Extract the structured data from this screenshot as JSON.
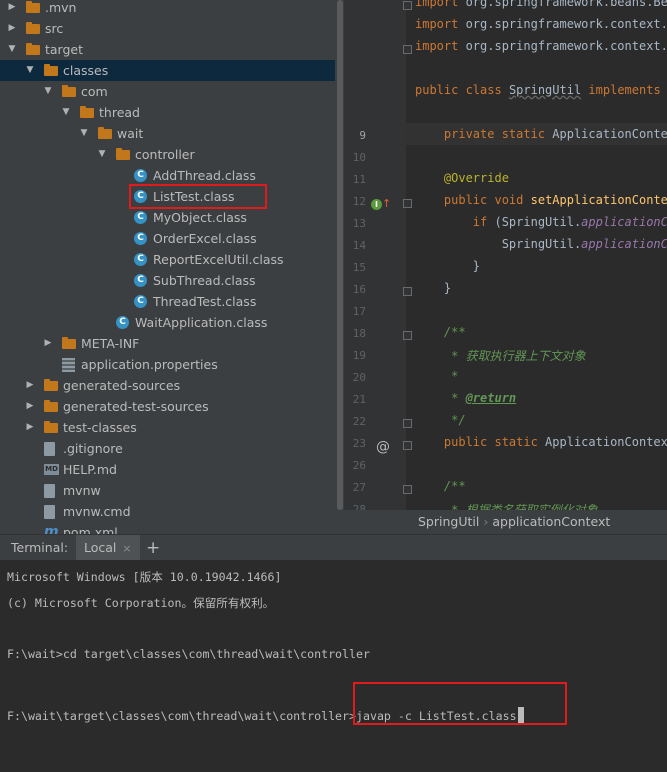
{
  "tree": {
    "items": [
      {
        "label": ".mvn",
        "icon": "folder",
        "depth": 0,
        "arrow": "right"
      },
      {
        "label": "src",
        "icon": "folder",
        "depth": 0,
        "arrow": "right"
      },
      {
        "label": "target",
        "icon": "folder",
        "depth": 0,
        "arrow": "down"
      },
      {
        "label": "classes",
        "icon": "folder",
        "depth": 1,
        "arrow": "down",
        "selected": true
      },
      {
        "label": "com",
        "icon": "folder",
        "depth": 2,
        "arrow": "down"
      },
      {
        "label": "thread",
        "icon": "folder",
        "depth": 3,
        "arrow": "down"
      },
      {
        "label": "wait",
        "icon": "folder",
        "depth": 4,
        "arrow": "down"
      },
      {
        "label": "controller",
        "icon": "folder",
        "depth": 5,
        "arrow": "down"
      },
      {
        "label": "AddThread.class",
        "icon": "class",
        "depth": 6
      },
      {
        "label": "ListTest.class",
        "icon": "class",
        "depth": 6,
        "highlighted": true
      },
      {
        "label": "MyObject.class",
        "icon": "class",
        "depth": 6
      },
      {
        "label": "OrderExcel.class",
        "icon": "class",
        "depth": 6
      },
      {
        "label": "ReportExcelUtil.class",
        "icon": "class",
        "depth": 6
      },
      {
        "label": "SubThread.class",
        "icon": "class",
        "depth": 6
      },
      {
        "label": "ThreadTest.class",
        "icon": "class",
        "depth": 6
      },
      {
        "label": "WaitApplication.class",
        "icon": "class",
        "depth": 5
      },
      {
        "label": "META-INF",
        "icon": "folder",
        "depth": 2,
        "arrow": "right"
      },
      {
        "label": "application.properties",
        "icon": "properties",
        "depth": 2
      },
      {
        "label": "generated-sources",
        "icon": "folder",
        "depth": 1,
        "arrow": "right"
      },
      {
        "label": "generated-test-sources",
        "icon": "folder",
        "depth": 1,
        "arrow": "right"
      },
      {
        "label": "test-classes",
        "icon": "folder",
        "depth": 1,
        "arrow": "right"
      },
      {
        "label": ".gitignore",
        "icon": "file",
        "depth": 1
      },
      {
        "label": "HELP.md",
        "icon": "markdown",
        "depth": 1
      },
      {
        "label": "mvnw",
        "icon": "file",
        "depth": 1
      },
      {
        "label": "mvnw.cmd",
        "icon": "file",
        "depth": 1
      },
      {
        "label": "pom.xml",
        "icon": "maven",
        "depth": 1
      }
    ]
  },
  "editor": {
    "lines": [
      {
        "num": "",
        "html": "<span class=\"kw\">import</span> org.springframework.beans.BeansException;"
      },
      {
        "num": "",
        "html": "<span class=\"kw\">import</span> org.springframework.context.ApplicationContext;"
      },
      {
        "num": "",
        "html": "<span class=\"kw\">import</span> org.springframework.context.ApplicationContextAware;"
      },
      {
        "num": "",
        "html": ""
      },
      {
        "num": "",
        "html": "<span class=\"kw\">public class</span> <span class=\"squig\">SpringUtil</span> <span class=\"kw\">implements</span> ApplicationContextAware {"
      },
      {
        "num": "",
        "html": ""
      },
      {
        "num": "9",
        "html": "    <span class=\"kw\">private static</span> ApplicationContext <span class=\"st\">applicationContext</span>;"
      },
      {
        "num": "10",
        "html": ""
      },
      {
        "num": "11",
        "html": "    <span class=\"ann\">@Override</span>"
      },
      {
        "num": "12",
        "html": "    <span class=\"kw\">public void</span> <span class=\"fn\">setApplicationContext</span>(ApplicationContext applicationContext)"
      },
      {
        "num": "13",
        "html": "        <span class=\"kw\">if</span> (SpringUtil.<span class=\"st\">applicationContext</span> == <span class=\"kw\">null</span>) {"
      },
      {
        "num": "14",
        "html": "            SpringUtil.<span class=\"st\">applicationContext</span> = applicationContext;"
      },
      {
        "num": "15",
        "html": "        }"
      },
      {
        "num": "16",
        "html": "    }"
      },
      {
        "num": "17",
        "html": ""
      },
      {
        "num": "18",
        "html": "    <span class=\"cm\">/**</span>"
      },
      {
        "num": "19",
        "html": "<span class=\"cm\">     * 获取执行器上下文对象</span>"
      },
      {
        "num": "20",
        "html": "<span class=\"cm\">     *</span>"
      },
      {
        "num": "21",
        "html": "<span class=\"cm\">     * </span><span class=\"tag\">@return</span>"
      },
      {
        "num": "22",
        "html": "<span class=\"cm\">     */</span>"
      },
      {
        "num": "23",
        "html": "    <span class=\"kw\">public static</span> ApplicationContext <span class=\"fn\">getApplicationContext</span>() {"
      },
      {
        "num": "26",
        "html": ""
      },
      {
        "num": "27",
        "html": "    <span class=\"cm\">/**</span>"
      },
      {
        "num": "28",
        "html": "<span class=\"cm\">     * 根据类名获取实例化对象</span>"
      }
    ],
    "breadcrumb": {
      "class": "SpringUtil",
      "member": "applicationContext"
    }
  },
  "terminal": {
    "title": "Terminal:",
    "tab_label": "Local",
    "close_glyph": "×",
    "add_glyph": "+",
    "lines": [
      "Microsoft Windows [版本 10.0.19042.1466]",
      "(c) Microsoft Corporation。保留所有权利。",
      "",
      "F:\\wait>cd target\\classes\\com\\thread\\wait\\controller",
      ""
    ],
    "prompt": "F:\\wait\\target\\classes\\com\\thread\\wait\\controller>",
    "command": "javap -c ListTest.class"
  },
  "colors": {
    "highlight_box": "#e01b1b",
    "selection": "#0d293e",
    "folder": "#c2771a",
    "class_icon": "#3592c4"
  }
}
